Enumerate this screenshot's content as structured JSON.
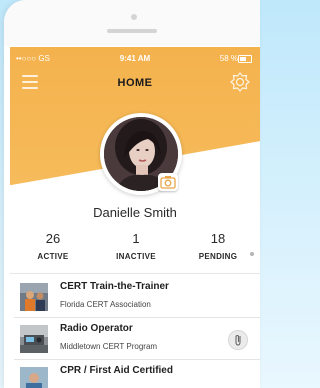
{
  "status_bar": {
    "carrier": "••○○○ GS",
    "time": "9:41 AM",
    "battery": "58 %"
  },
  "nav": {
    "title": "HOME",
    "menu_icon": "hamburger-menu-icon",
    "right_icon": "badge-award-icon"
  },
  "profile": {
    "name": "Danielle Smith"
  },
  "stats": [
    {
      "value": "26",
      "label": "ACTIVE"
    },
    {
      "value": "1",
      "label": "INACTIVE"
    },
    {
      "value": "18",
      "label": "PENDING"
    }
  ],
  "certifications": [
    {
      "title": "CERT Train-the-Trainer",
      "org": "Florida CERT Association"
    },
    {
      "title": "Radio Operator",
      "org": "Middletown CERT Program",
      "attachment_icon": "paperclip-icon"
    },
    {
      "title": "CPR / First Aid Certified",
      "org": ""
    }
  ],
  "colors": {
    "header_orange": "#f4b24d",
    "background": "#ffffff"
  }
}
